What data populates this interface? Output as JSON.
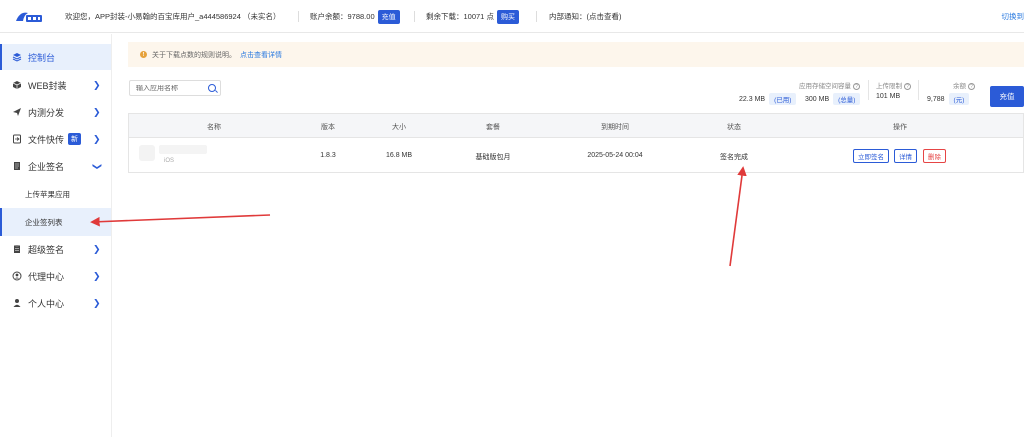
{
  "header": {
    "welcome": "欢迎您，APP封装-小易翰的百宝库用户_a444586924 （未实名）",
    "balance_label": "账户余额：9788.00",
    "recharge_label": "充值",
    "downloads_label": "剩余下载：10071 点",
    "buy_label": "购买",
    "notice_label": "内部通知：(点击查看)",
    "switch_label": "切换到"
  },
  "sidebar": {
    "items": [
      {
        "label": "控制台",
        "icon": "layers-icon"
      },
      {
        "label": "WEB封装",
        "icon": "cube-icon"
      },
      {
        "label": "内测分发",
        "icon": "send-icon"
      },
      {
        "label": "文件快传",
        "icon": "file-icon",
        "badge": "新"
      },
      {
        "label": "企业签名",
        "icon": "document-icon"
      },
      {
        "label": "超级签名",
        "icon": "clipboard-icon"
      },
      {
        "label": "代理中心",
        "icon": "user-circle-icon"
      },
      {
        "label": "个人中心",
        "icon": "user-icon"
      }
    ],
    "sub_items": [
      {
        "label": "上传苹果应用"
      },
      {
        "label": "企业签列表"
      }
    ]
  },
  "notice": {
    "text": "关于下载点数的规则说明。",
    "link": "点击查看详情"
  },
  "search": {
    "placeholder": "输入应用名称"
  },
  "stats": {
    "storage_label": "应用存储空间容量",
    "storage_used": "22.3 MB",
    "used_tag": "(已用)",
    "storage_total": "300 MB",
    "total_tag": "(总量)",
    "upload_label": "上传限制",
    "upload_value": "101 MB",
    "balance_label": "余额",
    "balance_value": "9,788",
    "unit_tag": "(元)",
    "recharge_label": "充值"
  },
  "table": {
    "headers": [
      "名称",
      "版本",
      "大小",
      "套餐",
      "到期时间",
      "状态",
      "操作"
    ],
    "rows": [
      {
        "os": "iOS",
        "version": "1.8.3",
        "size": "16.8 MB",
        "plan": "基础版包月",
        "expire": "2025-05-24 00:04",
        "status": "签名完成",
        "actions": [
          "立即签名",
          "详情",
          "删除"
        ]
      }
    ]
  },
  "colors": {
    "primary": "#2b5bd7",
    "danger": "#e64545",
    "arrow": "#e03a3a",
    "notice_bg": "#fdf6ec"
  }
}
